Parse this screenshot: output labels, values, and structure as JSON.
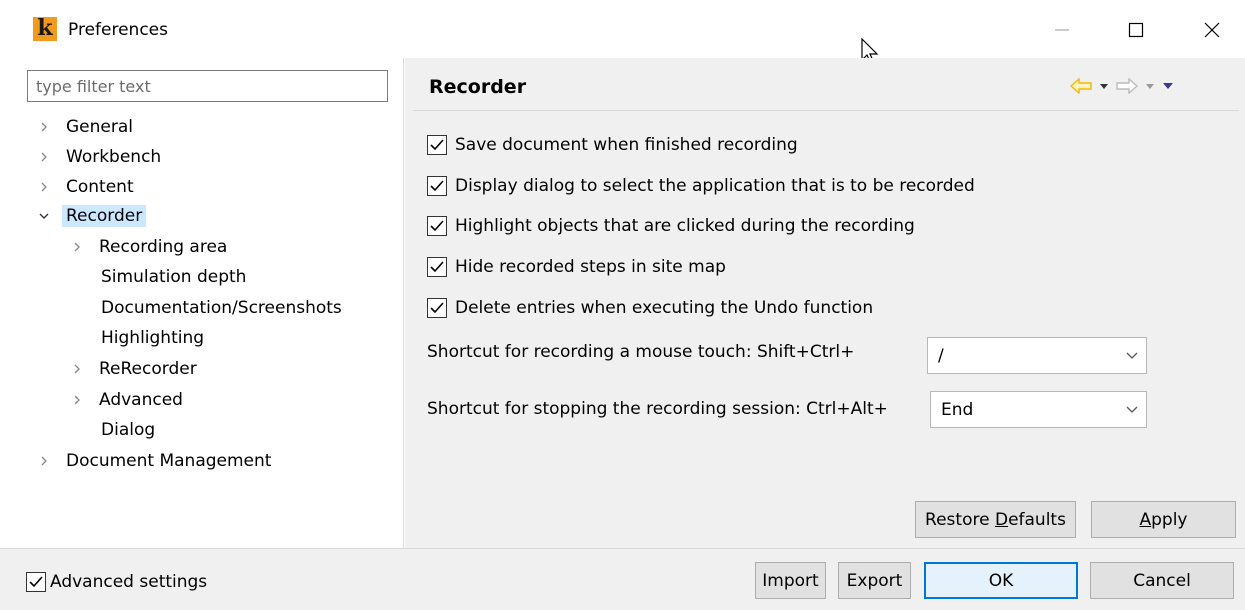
{
  "window": {
    "title": "Preferences",
    "app_icon_letter": "k",
    "app_icon_color": "#f39a1e"
  },
  "filter": {
    "placeholder": "type filter text",
    "value": ""
  },
  "tree": {
    "items": [
      {
        "label": "General",
        "expandable": true,
        "expanded": false
      },
      {
        "label": "Workbench",
        "expandable": true,
        "expanded": false
      },
      {
        "label": "Content",
        "expandable": true,
        "expanded": false
      },
      {
        "label": "Recorder",
        "expandable": true,
        "expanded": true,
        "selected": true
      },
      {
        "label": "Recording area",
        "expandable": true,
        "expanded": false
      },
      {
        "label": "Simulation depth",
        "expandable": false
      },
      {
        "label": "Documentation/Screenshots",
        "expandable": false
      },
      {
        "label": "Highlighting",
        "expandable": false
      },
      {
        "label": "ReRecorder",
        "expandable": true,
        "expanded": false
      },
      {
        "label": "Advanced",
        "expandable": true,
        "expanded": false
      },
      {
        "label": "Dialog",
        "expandable": false
      },
      {
        "label": "Document Management",
        "expandable": true,
        "expanded": false
      }
    ]
  },
  "page": {
    "title": "Recorder",
    "options": [
      {
        "label": "Save document when finished recording",
        "checked": true
      },
      {
        "label": "Display dialog to select the application that is to be recorded",
        "checked": true
      },
      {
        "label": "Highlight objects that are clicked during the recording",
        "checked": true
      },
      {
        "label": "Hide recorded steps in site map",
        "checked": true
      },
      {
        "label": "Delete entries when executing the Undo function",
        "checked": true
      }
    ],
    "shortcut_touch": {
      "label": "Shortcut for recording a mouse touch: Shift+Ctrl+",
      "value": "/"
    },
    "shortcut_stop": {
      "label": "Shortcut for stopping the recording session: Ctrl+Alt+",
      "value": "End"
    },
    "restore_defaults": {
      "pre": "Restore ",
      "mnemonic": "D",
      "post": "efaults"
    },
    "apply": {
      "pre": "",
      "mnemonic": "A",
      "post": "pply"
    }
  },
  "footer": {
    "advanced_settings": {
      "label": "Advanced settings",
      "checked": true
    },
    "import_label": "Import",
    "export_label": "Export",
    "ok_label": "OK",
    "cancel_label": "Cancel"
  },
  "colors": {
    "selection": "#cce8ff",
    "accent": "#0078d7",
    "nav_back": "#f5b800"
  }
}
